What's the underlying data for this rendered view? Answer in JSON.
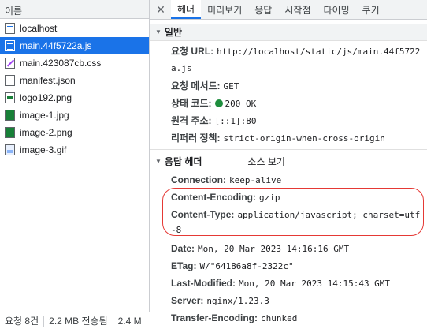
{
  "left_panel": {
    "header": "이름",
    "files": [
      {
        "name": "localhost",
        "icon": "document-icon"
      },
      {
        "name": "main.44f5722a.js",
        "icon": "script-icon"
      },
      {
        "name": "main.423087cb.css",
        "icon": "stylesheet-icon"
      },
      {
        "name": "manifest.json",
        "icon": "file-icon"
      },
      {
        "name": "logo192.png",
        "icon": "png-image-icon"
      },
      {
        "name": "image-1.jpg",
        "icon": "image-icon"
      },
      {
        "name": "image-2.png",
        "icon": "image-icon"
      },
      {
        "name": "image-3.gif",
        "icon": "gif-image-icon"
      }
    ],
    "selected_index": 1,
    "footer": {
      "requests": "요청 8건",
      "transferred": "2.2 MB 전송됨",
      "resources": "2.4 M"
    }
  },
  "tabs": {
    "close_glyph": "✕",
    "items": [
      "헤더",
      "미리보기",
      "응답",
      "시작점",
      "타이밍",
      "쿠키"
    ],
    "active_index": 0
  },
  "general": {
    "title": "일반",
    "request_url_label": "요청 URL:",
    "request_url_line1": "http://localhost/static/js/main.44f5722",
    "request_url_line2": "a.js",
    "method_label": "요청 메서드:",
    "method_value": "GET",
    "status_label": "상태 코드:",
    "status_value": "200 OK",
    "status_color": "#1e8e3e",
    "remote_label": "원격 주소:",
    "remote_value": "[::1]:80",
    "referrer_label": "리퍼러 정책:",
    "referrer_value": "strict-origin-when-cross-origin"
  },
  "response_headers": {
    "title": "응답 헤더",
    "view_source": "소스 보기",
    "connection_label": "Connection:",
    "connection_value": "keep-alive",
    "encoding_label": "Content-Encoding:",
    "encoding_value": "gzip",
    "type_label": "Content-Type:",
    "type_value_line1": "application/javascript; charset=utf",
    "type_value_line2": "-8",
    "date_label": "Date:",
    "date_value": "Mon, 20 Mar 2023 14:16:16 GMT",
    "etag_label": "ETag:",
    "etag_value": "W/\"64186a8f-2322c\"",
    "lastmod_label": "Last-Modified:",
    "lastmod_value": "Mon, 20 Mar 2023 14:15:43 GMT",
    "server_label": "Server:",
    "server_value": "nginx/1.23.3",
    "transfer_label": "Transfer-Encoding:",
    "transfer_value": "chunked"
  },
  "highlight_color": "#e53935"
}
